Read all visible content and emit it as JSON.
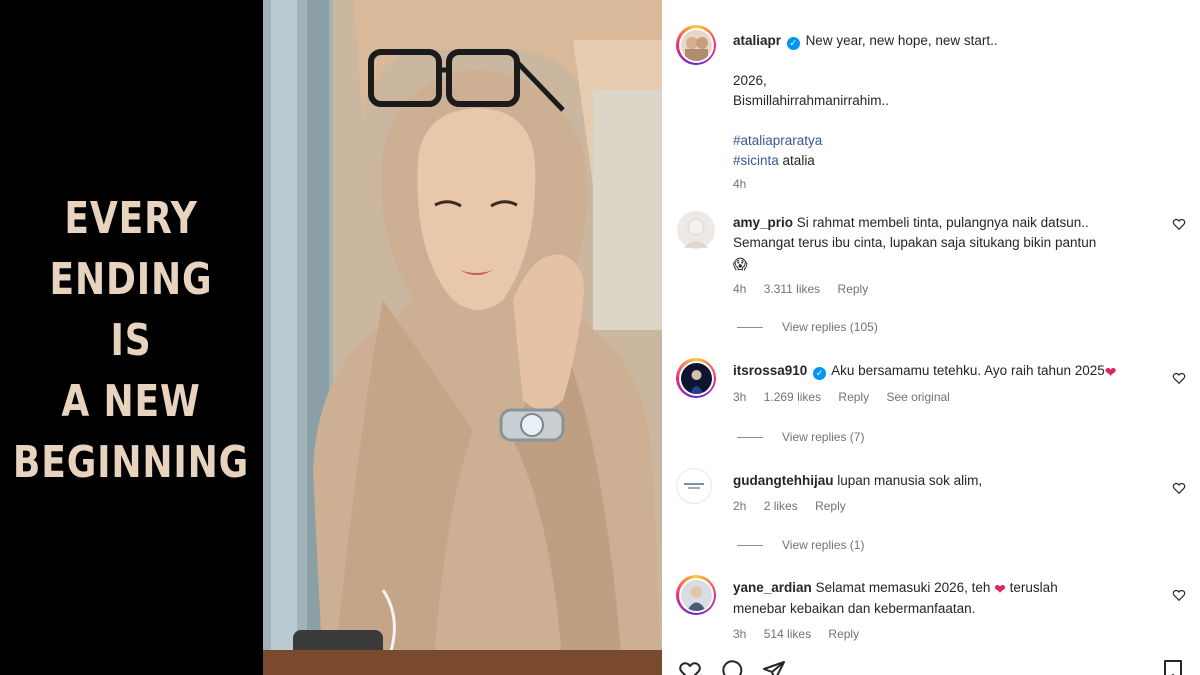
{
  "media": {
    "quote_lines": [
      "EVERY",
      "ENDING",
      "IS",
      "A NEW",
      "BEGINNING"
    ]
  },
  "post": {
    "author": "ataliapr",
    "caption_first": "New year, new hope, new start..",
    "caption_lines": [
      "2026,",
      "Bismillahirrahmanirrahim.."
    ],
    "hashtag_1": "#ataliapraratya",
    "hashtag_2": "#sicinta",
    "mention_after": "atalia",
    "time": "4h"
  },
  "comments": [
    {
      "username": "amy_prio",
      "text_line1": "Si rahmat membeli tinta, pulangnya naik datsun..",
      "text_line2": "Semangat terus ibu cinta, lupakan saja situkang bikin pantun",
      "emoji": "😱",
      "time": "4h",
      "likes": "3.311 likes",
      "reply": "Reply",
      "view_replies": "View replies (105)"
    },
    {
      "username": "itsrossa910",
      "text_line1": "Aku bersamamu tetehku. Ayo raih tahun 2025",
      "emoji": "❤",
      "time": "3h",
      "likes": "1.269 likes",
      "reply": "Reply",
      "see_original": "See original",
      "view_replies": "View replies (7)"
    },
    {
      "username": "gudangtehhijau",
      "text_line1": "lupan manusia sok alim,",
      "time": "2h",
      "likes": "2 likes",
      "reply": "Reply",
      "view_replies": "View replies (1)"
    },
    {
      "username": "yane_ardian",
      "text_line1_a": "Selamat memasuki 2026, teh",
      "emoji": "❤",
      "text_line1_b": "teruslah",
      "text_line2": "menebar kebaikan dan kebermanfaatan.",
      "time": "3h",
      "likes": "514 likes",
      "reply": "Reply"
    }
  ],
  "icons": {
    "verified": "verified-badge-icon",
    "like": "heart-outline-icon",
    "comment": "comment-icon",
    "share": "share-icon",
    "save": "bookmark-icon"
  },
  "colors": {
    "quote_text": "#e8d3bf",
    "verified": "#0095f6",
    "hashtag": "#385898",
    "meta": "#737373",
    "heart": "#e0245e"
  }
}
